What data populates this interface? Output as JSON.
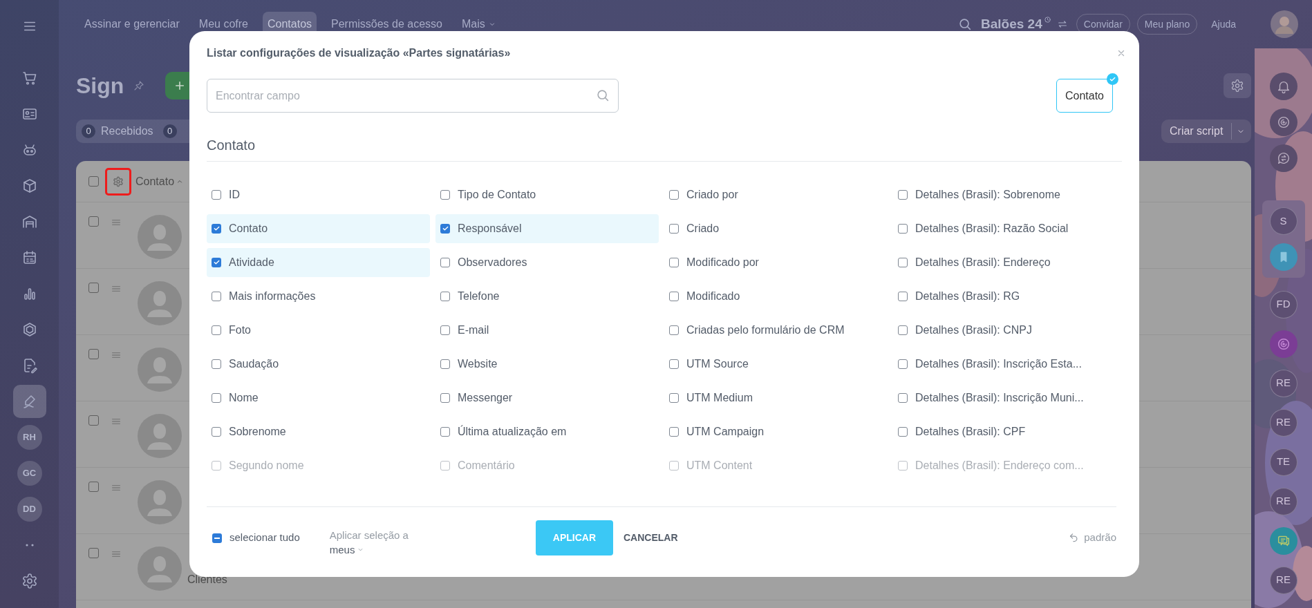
{
  "top_nav": {
    "items": [
      {
        "label": "Assinar e gerenciar",
        "selected": false,
        "menu": false
      },
      {
        "label": "Meu cofre",
        "selected": false,
        "menu": false
      },
      {
        "label": "Contatos",
        "selected": true,
        "menu": false
      },
      {
        "label": "Permissões de acesso",
        "selected": false,
        "menu": false
      },
      {
        "label": "Mais",
        "selected": false,
        "menu": true
      }
    ],
    "brand": "Balões 24",
    "buttons": [
      "Convidar",
      "Meu plano",
      "Ajuda"
    ]
  },
  "sidebar": {
    "items": [
      {
        "kind": "icon",
        "selected": false
      },
      {
        "kind": "icon",
        "selected": false
      },
      {
        "kind": "icon",
        "selected": false
      },
      {
        "kind": "icon",
        "selected": false
      },
      {
        "kind": "icon",
        "selected": false
      },
      {
        "kind": "icon",
        "selected": false
      },
      {
        "kind": "icon",
        "selected": false
      },
      {
        "kind": "icon",
        "selected": false
      },
      {
        "kind": "icon",
        "selected": false
      },
      {
        "kind": "icon",
        "selected": true
      },
      {
        "kind": "initials",
        "label": "RH",
        "selected": false
      },
      {
        "kind": "initials",
        "label": "GC",
        "selected": false
      },
      {
        "kind": "initials",
        "label": "DD",
        "selected": false
      },
      {
        "kind": "icon",
        "selected": false
      },
      {
        "kind": "icon",
        "selected": false
      }
    ]
  },
  "page": {
    "title": "Sign",
    "counters": [
      {
        "count": "0",
        "label": "Recebidos"
      },
      {
        "count": "0"
      }
    ],
    "action_button": "Criar script"
  },
  "table": {
    "all_checked": false,
    "sort_column": "Contato",
    "rows": [
      {
        "checked": false
      },
      {
        "checked": false
      },
      {
        "checked": false
      },
      {
        "checked": false
      },
      {
        "checked": false
      },
      {
        "checked": false,
        "name": "Clientes"
      }
    ]
  },
  "right_rail": {
    "items": [
      {
        "kind": "icon"
      },
      {
        "kind": "icon"
      },
      {
        "kind": "icon"
      }
    ],
    "pinned": [
      {
        "kind": "initials",
        "label": "S"
      },
      {
        "kind": "icon"
      }
    ],
    "chats": [
      {
        "kind": "initials",
        "label": "FD"
      },
      {
        "kind": "icon"
      },
      {
        "kind": "initials",
        "label": "RE"
      },
      {
        "kind": "initials",
        "label": "RE"
      },
      {
        "kind": "initials",
        "label": "TE"
      },
      {
        "kind": "initials",
        "label": "RE"
      },
      {
        "kind": "icon"
      },
      {
        "kind": "initials",
        "label": "RE"
      }
    ]
  },
  "modal": {
    "title": "Listar configurações de visualização «Partes signatárias»",
    "search": {
      "placeholder": "Encontrar campo"
    },
    "entities": [
      {
        "label": "Contato",
        "selected": true
      }
    ],
    "section": {
      "title": "Contato",
      "columns": [
        [
          {
            "label": "ID",
            "checked": false
          },
          {
            "label": "Contato",
            "checked": true
          },
          {
            "label": "Atividade",
            "checked": true
          },
          {
            "label": "Mais informações",
            "checked": false
          },
          {
            "label": "Foto",
            "checked": false
          },
          {
            "label": "Saudação",
            "checked": false
          },
          {
            "label": "Nome",
            "checked": false
          },
          {
            "label": "Sobrenome",
            "checked": false
          },
          {
            "label": "Segundo nome",
            "checked": false
          }
        ],
        [
          {
            "label": "Tipo de Contato",
            "checked": false
          },
          {
            "label": "Responsável",
            "checked": true
          },
          {
            "label": "Observadores",
            "checked": false
          },
          {
            "label": "Telefone",
            "checked": false
          },
          {
            "label": "E-mail",
            "checked": false
          },
          {
            "label": "Website",
            "checked": false
          },
          {
            "label": "Messenger",
            "checked": false
          },
          {
            "label": "Última atualização em",
            "checked": false
          },
          {
            "label": "Comentário",
            "checked": false
          }
        ],
        [
          {
            "label": "Criado por",
            "checked": false
          },
          {
            "label": "Criado",
            "checked": false
          },
          {
            "label": "Modificado por",
            "checked": false
          },
          {
            "label": "Modificado",
            "checked": false
          },
          {
            "label": "Criadas pelo formulário de CRM",
            "checked": false
          },
          {
            "label": "UTM Source",
            "checked": false
          },
          {
            "label": "UTM Medium",
            "checked": false
          },
          {
            "label": "UTM Campaign",
            "checked": false
          },
          {
            "label": "UTM Content",
            "checked": false
          }
        ],
        [
          {
            "label": "Detalhes (Brasil): Sobrenome",
            "checked": false
          },
          {
            "label": "Detalhes (Brasil): Razão Social",
            "checked": false
          },
          {
            "label": "Detalhes (Brasil): Endereço",
            "checked": false
          },
          {
            "label": "Detalhes (Brasil): RG",
            "checked": false
          },
          {
            "label": "Detalhes (Brasil): CNPJ",
            "checked": false
          },
          {
            "label": "Detalhes (Brasil): Inscrição Esta...",
            "checked": false
          },
          {
            "label": "Detalhes (Brasil): Inscrição Muni...",
            "checked": false
          },
          {
            "label": "Detalhes (Brasil): CPF",
            "checked": false
          },
          {
            "label": "Detalhes (Brasil): Endereço com...",
            "checked": false
          }
        ]
      ]
    },
    "footer": {
      "select_all": {
        "label": "selecionar tudo",
        "indeterminate": true
      },
      "apply_to": {
        "label": "Aplicar seleção a",
        "value": "meus"
      },
      "apply": "APLICAR",
      "cancel": "CANCELAR",
      "reset": "padrão"
    }
  }
}
